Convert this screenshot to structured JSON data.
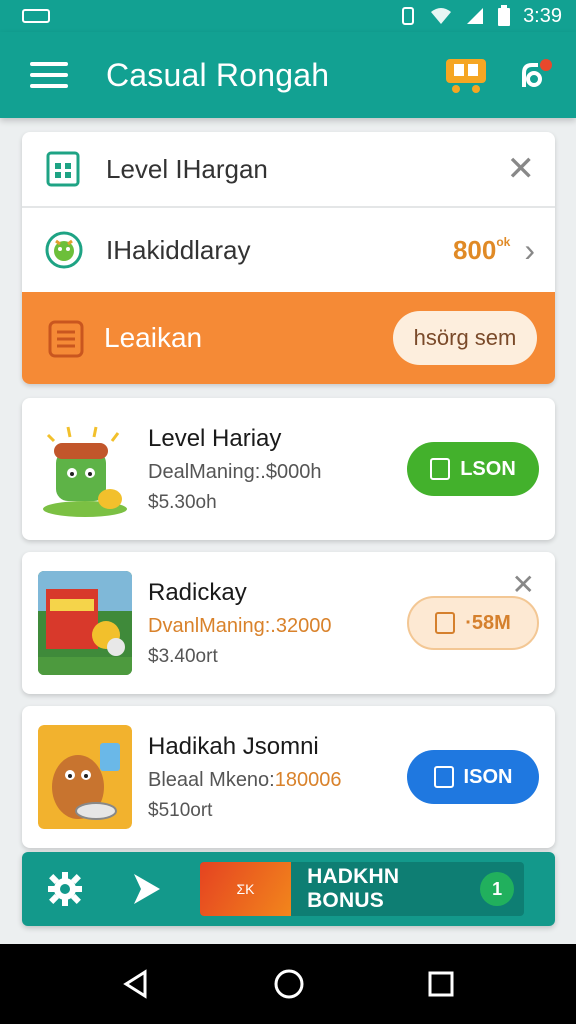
{
  "statusbar": {
    "time": "3:39"
  },
  "appbar": {
    "title": "Casual Rongah"
  },
  "top_card": {
    "row1": {
      "label": "Level IHargan",
      "close": "✕"
    },
    "row2": {
      "label": "IHakiddlaray",
      "amount": "800",
      "amount_sup": "ok"
    },
    "row3": {
      "label": "Leaikan",
      "button": "hsörg sem"
    }
  },
  "items": [
    {
      "name": "Level Hariay",
      "desc": "DealManing:.$000h",
      "price": "$5.30oh",
      "button": "LSON"
    },
    {
      "name": "Radickay",
      "desc": "DvanlManing:.32000",
      "price": "$3.40ort",
      "button": "·58M"
    },
    {
      "name": "Hadikah Jsomni",
      "desc_a": "Bleaal Mkeno:",
      "desc_b": "180006",
      "price": "$510ort",
      "button": "ISON"
    }
  ],
  "bonus": {
    "flag_text": "ΣK",
    "label": "HADKHN BONUS",
    "badge": "1"
  },
  "colors": {
    "teal": "#12a192",
    "orange": "#f58a36",
    "green": "#43b12c",
    "blue": "#1f78e0"
  }
}
